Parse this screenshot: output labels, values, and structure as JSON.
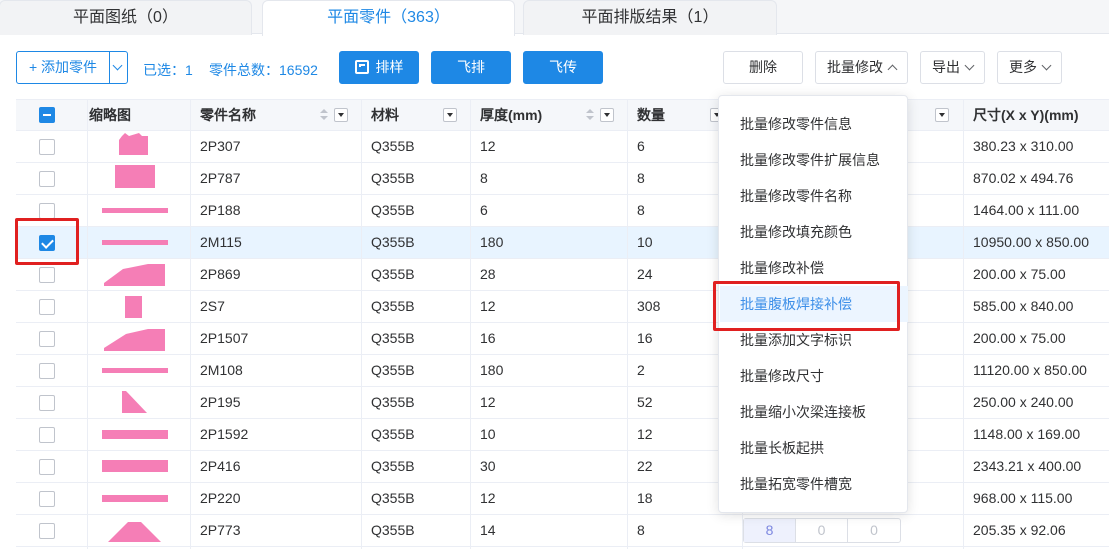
{
  "tabs": [
    {
      "label": "平面图纸（0）",
      "active": false
    },
    {
      "label": "平面零件（363）",
      "active": true
    },
    {
      "label": "平面排版结果（1）",
      "active": false
    }
  ],
  "toolbar": {
    "add_label": "+ 添加零件",
    "selected_text": "已选：1",
    "total_text": "零件总数：16592",
    "nest_label": "排样",
    "fly_nest_label": "飞排",
    "fly_upload_label": "飞传",
    "delete_label": "删除",
    "batch_edit_label": "批量修改",
    "export_label": "导出",
    "more_label": "更多"
  },
  "table": {
    "headers": {
      "thumb": "缩略图",
      "name": "零件名称",
      "material": "材料",
      "thickness": "厚度(mm)",
      "quantity": "数量",
      "size": "尺寸(X x Y)(mm)"
    },
    "rows": [
      {
        "name": "2P307",
        "material": "Q355B",
        "thickness": "12",
        "quantity": "6",
        "size": "380.23 x 310.00",
        "checked": false
      },
      {
        "name": "2P787",
        "material": "Q355B",
        "thickness": "8",
        "quantity": "8",
        "size": "870.02 x 494.76",
        "checked": false
      },
      {
        "name": "2P188",
        "material": "Q355B",
        "thickness": "6",
        "quantity": "8",
        "size": "1464.00 x 111.00",
        "checked": false
      },
      {
        "name": "2M115",
        "material": "Q355B",
        "thickness": "180",
        "quantity": "10",
        "size": "10950.00 x 850.00",
        "checked": true
      },
      {
        "name": "2P869",
        "material": "Q355B",
        "thickness": "28",
        "quantity": "24",
        "size": "200.00 x 75.00",
        "checked": false
      },
      {
        "name": "2S7",
        "material": "Q355B",
        "thickness": "12",
        "quantity": "308",
        "size": "585.00 x 840.00",
        "checked": false
      },
      {
        "name": "2P1507",
        "material": "Q355B",
        "thickness": "16",
        "quantity": "16",
        "size": "200.00 x 75.00",
        "checked": false
      },
      {
        "name": "2M108",
        "material": "Q355B",
        "thickness": "180",
        "quantity": "2",
        "size": "11120.00 x 850.00",
        "checked": false
      },
      {
        "name": "2P195",
        "material": "Q355B",
        "thickness": "12",
        "quantity": "52",
        "size": "250.00 x 240.00",
        "checked": false
      },
      {
        "name": "2P1592",
        "material": "Q355B",
        "thickness": "10",
        "quantity": "12",
        "size": "1148.00 x 169.00",
        "checked": false
      },
      {
        "name": "2P416",
        "material": "Q355B",
        "thickness": "30",
        "quantity": "22",
        "size": "2343.21 x 400.00",
        "checked": false
      },
      {
        "name": "2P220",
        "material": "Q355B",
        "thickness": "12",
        "quantity": "18",
        "size": "968.00 x 115.00",
        "checked": false
      },
      {
        "name": "2P773",
        "material": "Q355B",
        "thickness": "14",
        "quantity": "8",
        "size": "205.35 x 92.06",
        "checked": false
      }
    ],
    "last_row_counts": [
      "8",
      "0",
      "0"
    ]
  },
  "batch_menu": {
    "items": [
      "批量修改零件信息",
      "批量修改零件扩展信息",
      "批量修改零件名称",
      "批量修改填充颜色",
      "批量修改补偿",
      "批量腹板焊接补偿",
      "批量添加文字标识",
      "批量修改尺寸",
      "批量缩小次梁连接板",
      "批量长板起拱",
      "批量拓宽零件槽宽"
    ],
    "highlighted_index": 5
  },
  "colors": {
    "primary": "#1e88e5",
    "part_fill": "#f57eb6",
    "highlight_box": "#e02020",
    "selected_row": "#e8f4ff"
  },
  "icons": {
    "nest_button": "nest-logo-icon",
    "add_dropdown": "chevron-down-icon"
  }
}
